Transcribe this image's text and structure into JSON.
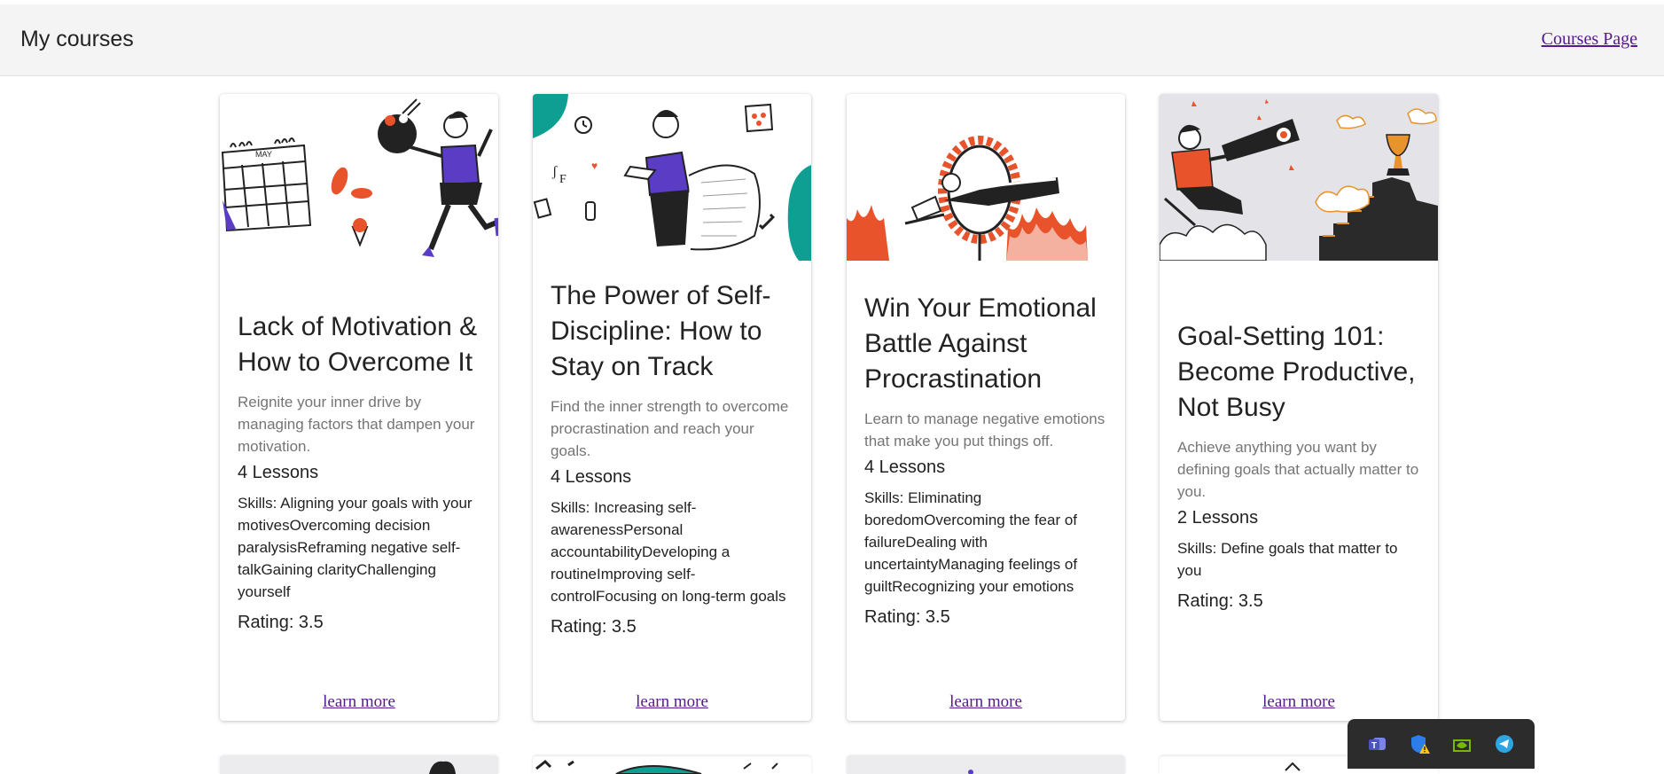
{
  "header": {
    "title": "My courses",
    "courses_link": "Courses Page"
  },
  "courses": [
    {
      "title": "Lack of Motivation & How to Overcome It",
      "description": "Reignite your inner drive by managing factors that dampen your motivation.",
      "lessons": "4 Lessons",
      "skills": "Skills: Aligning your goals with your motivesOvercoming decision paralysisReframing negative self-talkGaining clarityChallenging yourself",
      "rating": "Rating: 3.5",
      "link": "learn more",
      "illustration": "woman-running-with-calendar"
    },
    {
      "title": "The Power of Self-Discipline: How to Stay on Track",
      "description": "Find the inner strength to overcome procrastination and reach your goals.",
      "lessons": "4 Lessons",
      "skills": "Skills: Increasing self-awarenessPersonal accountabilityDeveloping a routineImproving self-controlFocusing on long-term goals",
      "rating": "Rating: 3.5",
      "link": "learn more",
      "illustration": "woman-reading-list"
    },
    {
      "title": "Win Your Emotional Battle Against Procrastination",
      "description": "Learn to manage negative emotions that make you put things off.",
      "lessons": "4 Lessons",
      "skills": "Skills: Eliminating boredomOvercoming the fear of failureDealing with uncertaintyManaging feelings of guiltRecognizing your emotions",
      "rating": "Rating: 3.5",
      "link": "learn more",
      "illustration": "man-jumping-through-fire-ring"
    },
    {
      "title": "Goal-Setting 101: Become Productive, Not Busy",
      "description": "Achieve anything you want by defining goals that actually matter to you.",
      "lessons": "2 Lessons",
      "skills": "Skills: Define goals that matter to you",
      "rating": "Rating: 3.5",
      "link": "learn more",
      "illustration": "woman-with-telescope-trophy"
    }
  ],
  "taskbar": {
    "icons": [
      "teams-icon",
      "security-warning-icon",
      "nvidia-icon",
      "telegram-icon"
    ]
  },
  "colors": {
    "link": "#551a8b",
    "accent_orange": "#e8532b",
    "accent_purple": "#5b3cc4",
    "accent_teal": "#0e9e92"
  }
}
